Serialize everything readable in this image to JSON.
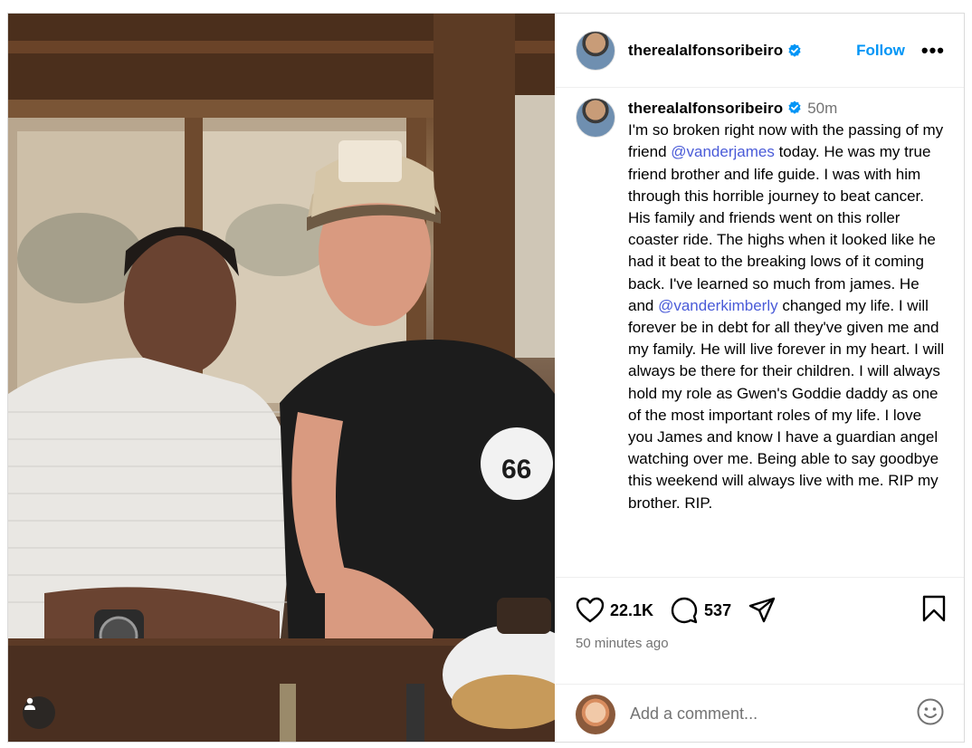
{
  "post": {
    "username": "therealalfonsoribeiro",
    "follow_label": "Follow",
    "more_label": "•••",
    "time_ago": "50m",
    "caption": {
      "p1": "I'm so broken right now with the passing of my friend ",
      "mention1": "@vanderjames",
      "p2": " today. He was my true friend brother and life guide. I was with him through this horrible journey to beat cancer. His family and friends went on this roller coaster ride. The highs when it looked like he had it beat to the breaking lows of it coming back. I've learned so much from james. He and ",
      "mention2": "@vanderkimberly",
      "p3": " changed my life. I will forever be in debt for all they've given me and my family. He will live forever in my heart. I will always be there for their children. I will always hold my role as Gwen's Goddie daddy as one of the most important roles of my life. I love you James and know I have a guardian angel watching over me. Being able to say goodbye this weekend will always live with me. RIP my brother. RIP."
    },
    "likes": "22.1K",
    "comments": "537",
    "timestamp": "50 minutes ago"
  },
  "comment_box": {
    "placeholder": "Add a comment..."
  },
  "icons": {
    "like": "heart-icon",
    "comment": "comment-icon",
    "share": "share-icon",
    "save": "bookmark-icon",
    "emoji": "emoji-icon",
    "verified": "verified-badge-icon",
    "tag": "user-tag-icon"
  },
  "colors": {
    "follow": "#0095f6",
    "mention": "#4a5bd8",
    "verified": "#0095f6",
    "muted": "#737373"
  }
}
